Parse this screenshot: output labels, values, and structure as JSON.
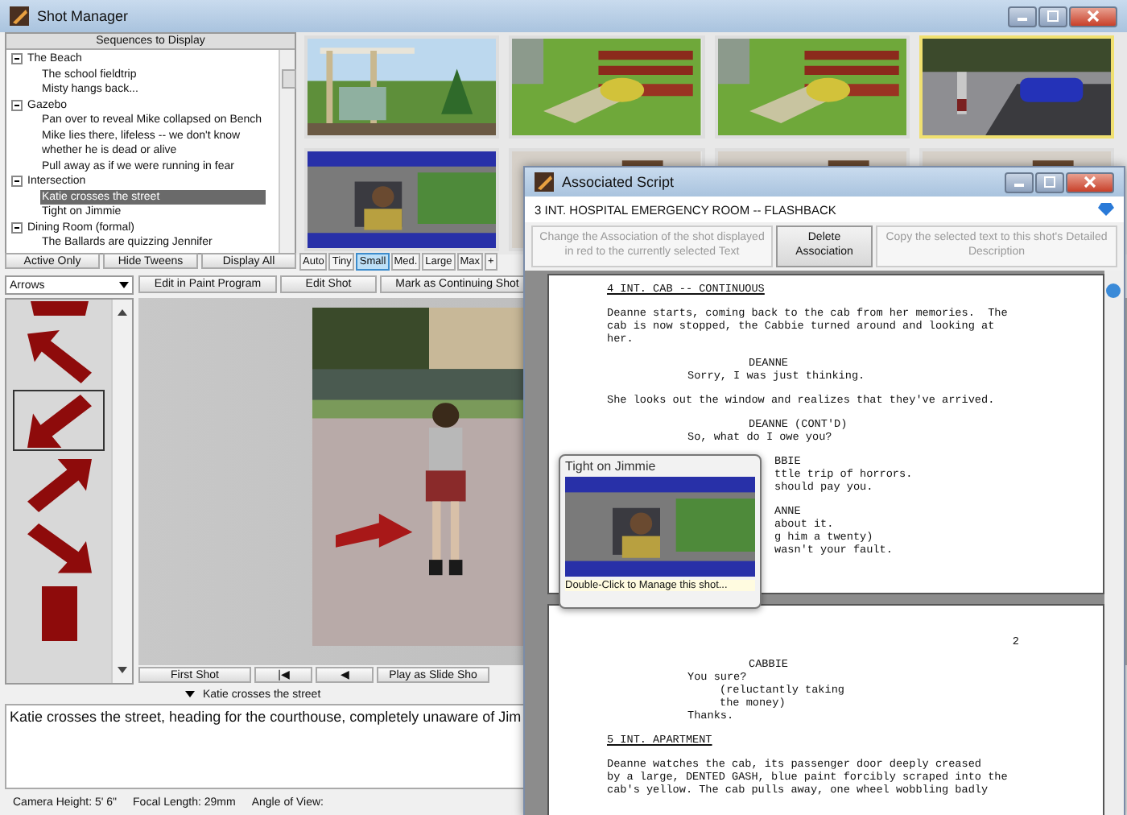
{
  "window": {
    "title": "Shot Manager"
  },
  "sequences": {
    "header": "Sequences to Display",
    "tree": [
      {
        "label": "The Beach",
        "expanded": true,
        "selected": false,
        "children": [
          {
            "label": "The school fieldtrip",
            "selected": false
          },
          {
            "label": "Misty hangs back...",
            "selected": false
          }
        ]
      },
      {
        "label": "Gazebo",
        "expanded": true,
        "selected": false,
        "children": [
          {
            "label": "Pan over to reveal Mike collapsed on Bench",
            "selected": false
          },
          {
            "label": "Mike lies there, lifeless -- we don't know whether he is dead or alive",
            "selected": false
          },
          {
            "label": "Pull away as if we were running in fear",
            "selected": false
          }
        ]
      },
      {
        "label": "Intersection",
        "expanded": true,
        "selected": false,
        "children": [
          {
            "label": "Katie crosses the street",
            "selected": true
          },
          {
            "label": "Tight on Jimmie",
            "selected": false
          }
        ]
      },
      {
        "label": "Dining Room (formal)",
        "expanded": true,
        "selected": false,
        "children": [
          {
            "label": "The Ballards are quizzing Jennifer",
            "selected": false
          }
        ]
      }
    ]
  },
  "filter_buttons": [
    "Active Only",
    "Hide Tweens",
    "Display All"
  ],
  "size_buttons": [
    {
      "label": "Auto",
      "selected": false
    },
    {
      "label": "Tiny",
      "selected": false
    },
    {
      "label": "Small",
      "selected": true
    },
    {
      "label": "Med.",
      "selected": false
    },
    {
      "label": "Large",
      "selected": false
    },
    {
      "label": "Max",
      "selected": false
    },
    {
      "label": "+",
      "selected": false
    }
  ],
  "thumbnails": [
    {
      "kind": "gazebo",
      "selected": false
    },
    {
      "kind": "bench",
      "selected": false
    },
    {
      "kind": "bench",
      "selected": false
    },
    {
      "kind": "street",
      "selected": true
    },
    {
      "kind": "car",
      "selected": false
    },
    {
      "kind": "room",
      "selected": false
    },
    {
      "kind": "room",
      "selected": false
    },
    {
      "kind": "room",
      "selected": false
    }
  ],
  "shot_editor": {
    "category": "Arrows",
    "arrows": [
      {
        "kind": "down",
        "selected": false
      },
      {
        "kind": "up-left",
        "selected": false
      },
      {
        "kind": "down-left",
        "selected": true
      },
      {
        "kind": "up-right",
        "selected": false
      },
      {
        "kind": "down-right",
        "selected": false
      },
      {
        "kind": "bar",
        "selected": false
      }
    ],
    "buttons": [
      "Edit in Paint Program",
      "Edit Shot",
      "Mark as Continuing Shot"
    ],
    "nav_buttons": [
      "First Shot",
      "|◀",
      "◀",
      "Play as Slide Sho"
    ]
  },
  "shot_title": "Katie crosses the street",
  "description": "Katie crosses the street, heading for the courthouse, completely unaware of Jim",
  "status": [
    "Camera Height: 5' 6\"",
    "Focal Length: 29mm",
    "Angle of View:"
  ],
  "script_window": {
    "title": "Associated Script",
    "scene": "3 INT. HOSPITAL EMERGENCY ROOM -- FLASHBACK",
    "buttons": [
      {
        "label": "Change the Association of the shot displayed in red to the currently selected Text",
        "disabled": true
      },
      {
        "label": "Delete Association",
        "disabled": false
      },
      {
        "label": "Copy the selected text to this shot's Detailed Description",
        "disabled": true
      }
    ],
    "pages": [
      {
        "lines": [
          {
            "kind": "heading",
            "text": "4 INT. CAB -- CONTINUOUS"
          },
          {
            "kind": "blank"
          },
          {
            "kind": "action",
            "text": "Deanne starts, coming back to the cab from her memories.  The"
          },
          {
            "kind": "action",
            "text": "cab is now stopped, the Cabbie turned around and looking at"
          },
          {
            "kind": "action",
            "text": "her."
          },
          {
            "kind": "blank"
          },
          {
            "kind": "character",
            "text": "DEANNE"
          },
          {
            "kind": "dialogue",
            "text": "Sorry, I was just thinking."
          },
          {
            "kind": "blank"
          },
          {
            "kind": "action",
            "text": "She looks out the window and realizes that they've arrived."
          },
          {
            "kind": "blank"
          },
          {
            "kind": "character",
            "text": "DEANNE (CONT'D)"
          },
          {
            "kind": "dialogue",
            "text": "So, what do I owe you?"
          },
          {
            "kind": "blank"
          },
          {
            "kind": "partial",
            "text": "BBIE"
          },
          {
            "kind": "partial",
            "text": "ttle trip of horrors."
          },
          {
            "kind": "partial",
            "text": "should pay you."
          },
          {
            "kind": "blank"
          },
          {
            "kind": "partial",
            "text": "ANNE"
          },
          {
            "kind": "partial",
            "text": "about it."
          },
          {
            "kind": "partial",
            "text": "g him a twenty)"
          },
          {
            "kind": "partial",
            "text": "wasn't your fault."
          }
        ]
      },
      {
        "number": "2",
        "lines": [
          {
            "kind": "character",
            "text": "CABBIE"
          },
          {
            "kind": "dialogue",
            "text": "You sure?"
          },
          {
            "kind": "paren",
            "text": "(reluctantly taking"
          },
          {
            "kind": "paren",
            "text": "the money)"
          },
          {
            "kind": "dialogue",
            "text": "Thanks."
          },
          {
            "kind": "blank"
          },
          {
            "kind": "heading",
            "text": "5 INT. APARTMENT"
          },
          {
            "kind": "blank"
          },
          {
            "kind": "action",
            "text": "Deanne watches the cab, its passenger door deeply creased"
          },
          {
            "kind": "action",
            "text": "by a large, DENTED GASH, blue paint forcibly scraped into the"
          },
          {
            "kind": "action",
            "text": "cab's yellow. The cab pulls away, one wheel wobbling badly"
          }
        ]
      }
    ]
  },
  "popup": {
    "title": "Tight on Jimmie",
    "hint": "Double-Click to Manage this shot..."
  }
}
